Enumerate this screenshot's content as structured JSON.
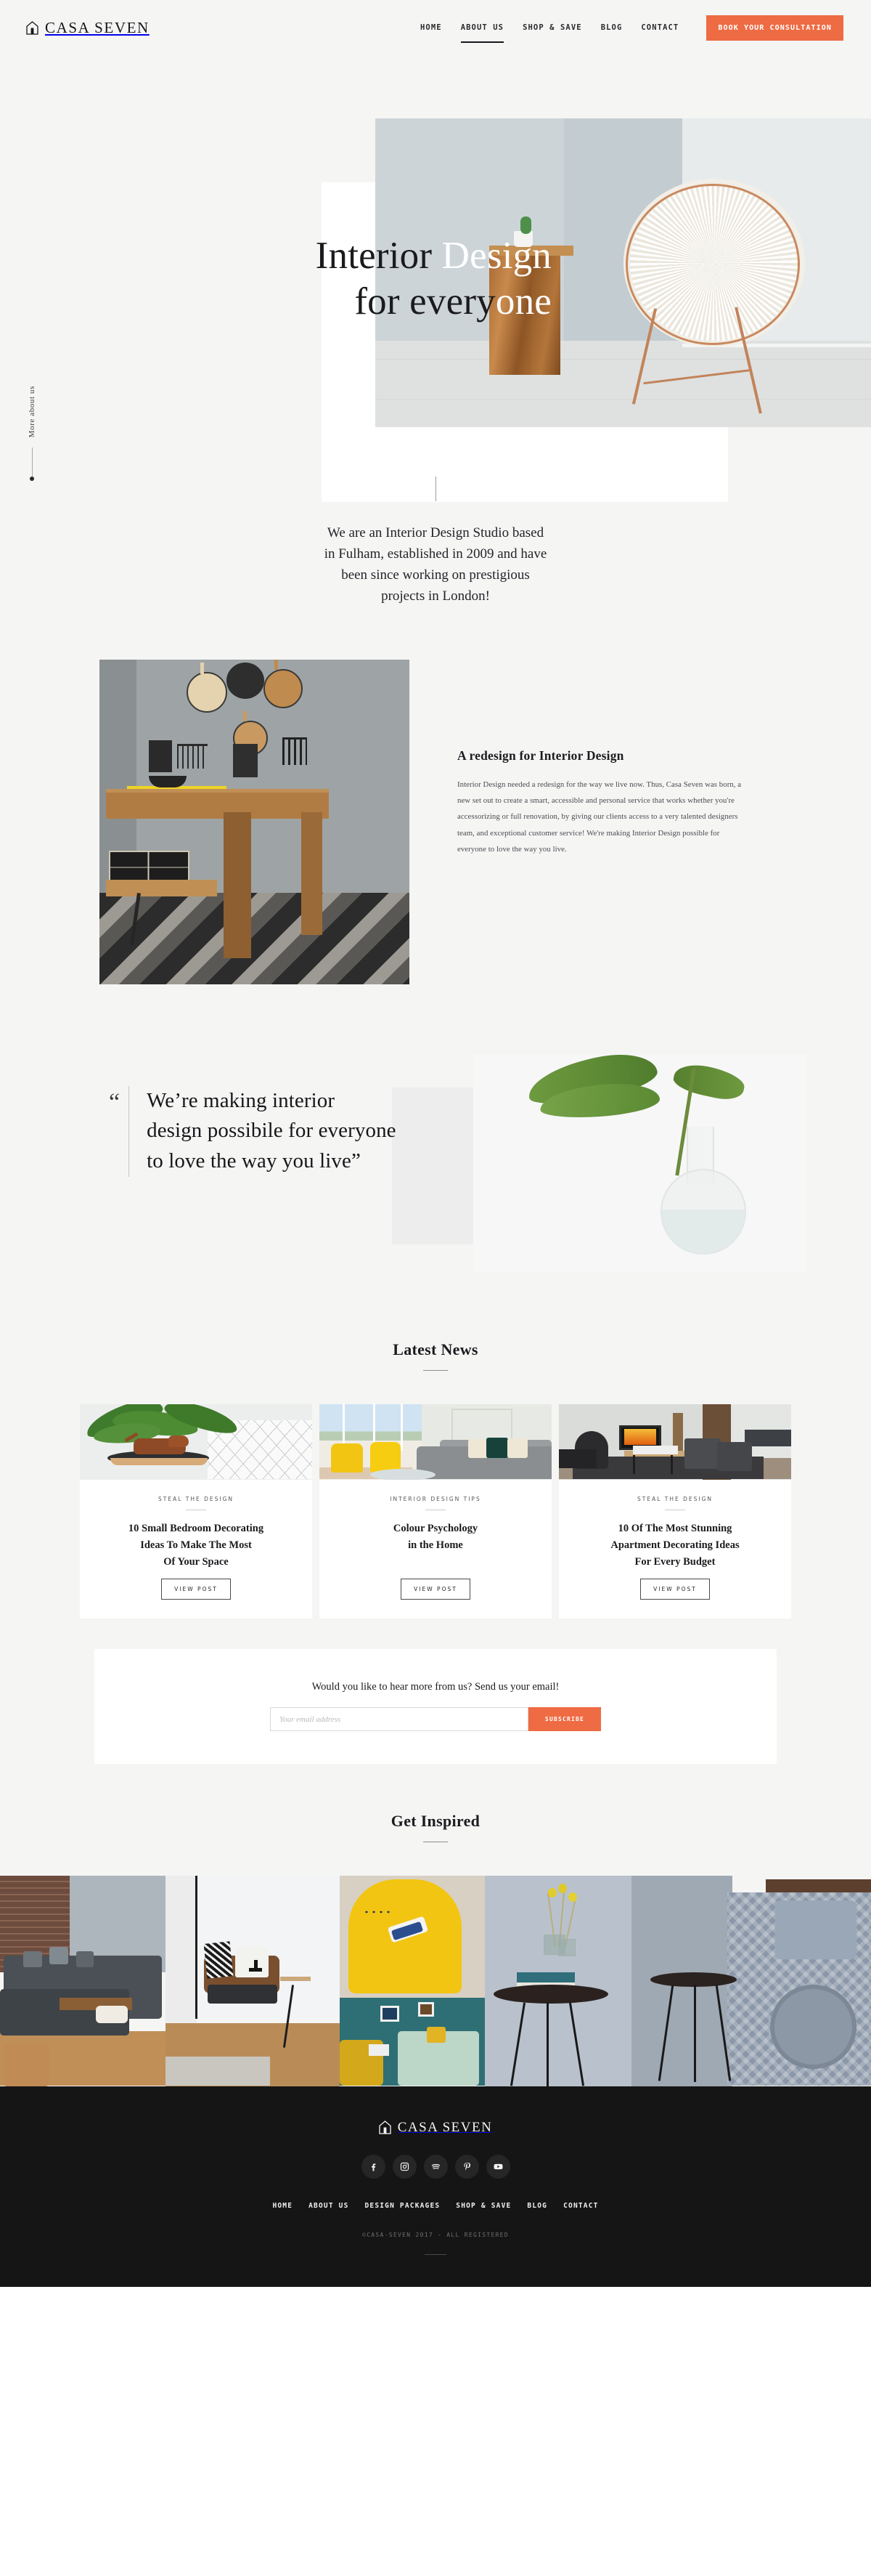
{
  "header": {
    "brand": "CASA SEVEN",
    "brand_icon": "house-icon",
    "nav": [
      {
        "label": "HOME",
        "active": false
      },
      {
        "label": "ABOUT US",
        "active": true
      },
      {
        "label": "SHOP & SAVE",
        "active": false
      },
      {
        "label": "BLOG",
        "active": false
      },
      {
        "label": "CONTACT",
        "active": false
      }
    ],
    "cta_label": "BOOK YOUR CONSULTATION",
    "cta_color": "#ee6b43"
  },
  "hero": {
    "title": "Interior Design\nfor everyone",
    "title_line1_dark": "Interior",
    "title_line1_light": "Design",
    "title_line2_dark": "for every",
    "title_line2_light": "one",
    "side_rail_label": "More about us"
  },
  "intro": {
    "text": "We are an Interior Design Studio based\nin Fulham, established in 2009 and have\nbeen since working on prestigious\nprojects in London!"
  },
  "redesign": {
    "title": "A redesign for Interior Design",
    "body": "Interior Design needed a redesign for the way we live now. Thus, Casa Seven was born, a new set out to create a smart, accessible and personal service that works whether you're accessorizing or full renovation, by giving our clients access to a very talented designers team, and exceptional customer service! We're making Interior Design possible for everyone to love the way you live."
  },
  "quote": {
    "mark": "“",
    "text": "We’re making interior\ndesign possibile for everyone\nto love the way you live”"
  },
  "news": {
    "heading": "Latest News",
    "cards": [
      {
        "category": "STEAL THE DESIGN",
        "title": "10 Small Bedroom Decorating\nIdeas To Make The Most\nOf Your Space",
        "button": "VIEW POST"
      },
      {
        "category": "INTERIOR DESIGN TIPS",
        "title": "Colour Psychology\nin the Home",
        "button": "VIEW POST"
      },
      {
        "category": "STEAL THE DESIGN",
        "title": "10 Of The Most Stunning\nApartment Decorating Ideas\nFor Every Budget",
        "button": "VIEW POST"
      }
    ]
  },
  "newsletter": {
    "title": "Would you like to hear more from us? Send us your email!",
    "placeholder": "Your email address",
    "value": "",
    "button": "SUBSCRIBE",
    "button_color": "#ee6b43"
  },
  "inspired": {
    "heading": "Get Inspired"
  },
  "footer": {
    "brand": "CASA SEVEN",
    "brand_icon": "house-icon",
    "socials": [
      {
        "name": "facebook-icon"
      },
      {
        "name": "instagram-icon"
      },
      {
        "name": "spotify-icon"
      },
      {
        "name": "pinterest-icon"
      },
      {
        "name": "youtube-icon"
      }
    ],
    "nav": [
      {
        "label": "HOME"
      },
      {
        "label": "ABOUT US"
      },
      {
        "label": "DESIGN PACKAGES"
      },
      {
        "label": "SHOP & SAVE"
      },
      {
        "label": "BLOG"
      },
      {
        "label": "CONTACT"
      }
    ],
    "copyright": "©CASA-SEVEN 2017 - ALL REGISTERED"
  }
}
